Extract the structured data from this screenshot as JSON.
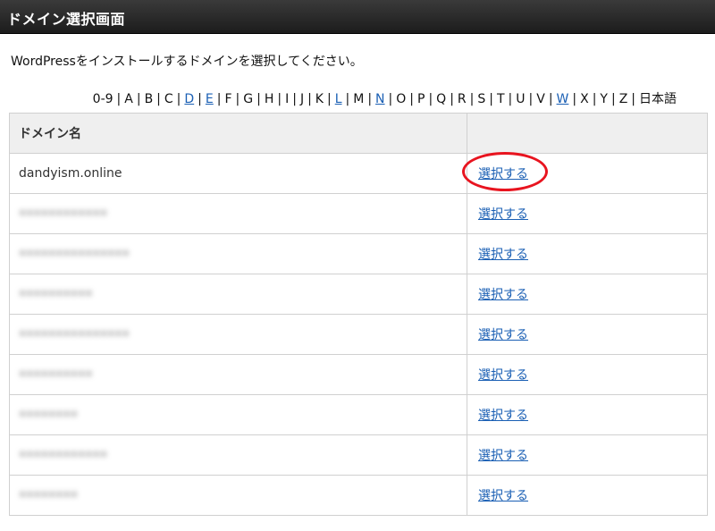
{
  "header": {
    "title": "ドメイン選択画面"
  },
  "description": "WordPressをインストールするドメインを選択してください。",
  "letter_nav": [
    {
      "label": "0-9",
      "link": false
    },
    {
      "label": "A",
      "link": false
    },
    {
      "label": "B",
      "link": false
    },
    {
      "label": "C",
      "link": false
    },
    {
      "label": "D",
      "link": true
    },
    {
      "label": "E",
      "link": true
    },
    {
      "label": "F",
      "link": false
    },
    {
      "label": "G",
      "link": false
    },
    {
      "label": "H",
      "link": false
    },
    {
      "label": "I",
      "link": false
    },
    {
      "label": "J",
      "link": false
    },
    {
      "label": "K",
      "link": false
    },
    {
      "label": "L",
      "link": true
    },
    {
      "label": "M",
      "link": false
    },
    {
      "label": "N",
      "link": true
    },
    {
      "label": "O",
      "link": false
    },
    {
      "label": "P",
      "link": false
    },
    {
      "label": "Q",
      "link": false
    },
    {
      "label": "R",
      "link": false
    },
    {
      "label": "S",
      "link": false
    },
    {
      "label": "T",
      "link": false
    },
    {
      "label": "U",
      "link": false
    },
    {
      "label": "V",
      "link": false
    },
    {
      "label": "W",
      "link": true
    },
    {
      "label": "X",
      "link": false
    },
    {
      "label": "Y",
      "link": false
    },
    {
      "label": "Z",
      "link": false
    },
    {
      "label": "日本語",
      "link": false
    }
  ],
  "table": {
    "header_domain": "ドメイン名",
    "header_action": "",
    "rows": [
      {
        "domain": "dandyism.online",
        "blurred": false,
        "action": "選択する",
        "highlighted": true
      },
      {
        "domain": "",
        "blurred": true,
        "action": "選択する",
        "highlighted": false
      },
      {
        "domain": "",
        "blurred": true,
        "action": "選択する",
        "highlighted": false
      },
      {
        "domain": "",
        "blurred": true,
        "action": "選択する",
        "highlighted": false
      },
      {
        "domain": "",
        "blurred": true,
        "action": "選択する",
        "highlighted": false
      },
      {
        "domain": "",
        "blurred": true,
        "action": "選択する",
        "highlighted": false
      },
      {
        "domain": "",
        "blurred": true,
        "action": "選択する",
        "highlighted": false
      },
      {
        "domain": "",
        "blurred": true,
        "action": "選択する",
        "highlighted": false
      },
      {
        "domain": "",
        "blurred": true,
        "action": "選択する",
        "highlighted": false
      }
    ]
  },
  "colors": {
    "link": "#1a5fb4",
    "highlight": "#e8141f",
    "titlebar": "#262626"
  }
}
